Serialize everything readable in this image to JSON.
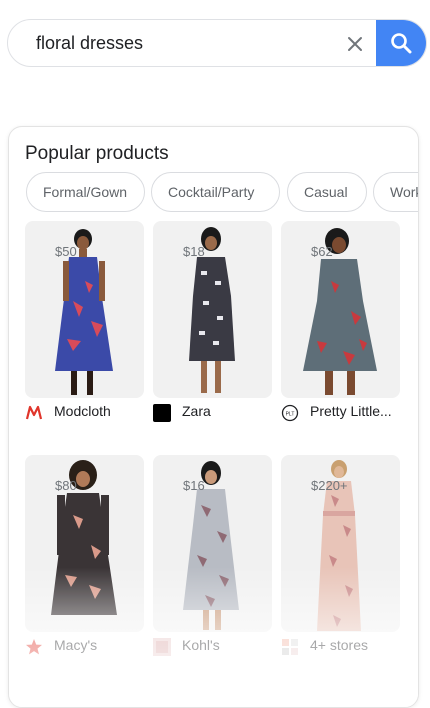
{
  "search": {
    "query": "floral dresses",
    "clear_icon": "close-icon",
    "search_icon": "search-icon",
    "accent_color": "#4285f4"
  },
  "popular": {
    "title": "Popular products",
    "chips": [
      {
        "label": "Formal/Gown"
      },
      {
        "label": "Cocktail/Party"
      },
      {
        "label": "Casual"
      },
      {
        "label": "Workw"
      }
    ],
    "products": [
      {
        "store": "Modcloth",
        "price": "$50"
      },
      {
        "store": "Zara",
        "price": "$18"
      },
      {
        "store": "Pretty Little...",
        "price": "$62"
      },
      {
        "store": "Macy's",
        "price": "$80"
      },
      {
        "store": "Kohl's",
        "price": "$16"
      },
      {
        "store": "4+ stores",
        "price": "$220+"
      }
    ]
  }
}
